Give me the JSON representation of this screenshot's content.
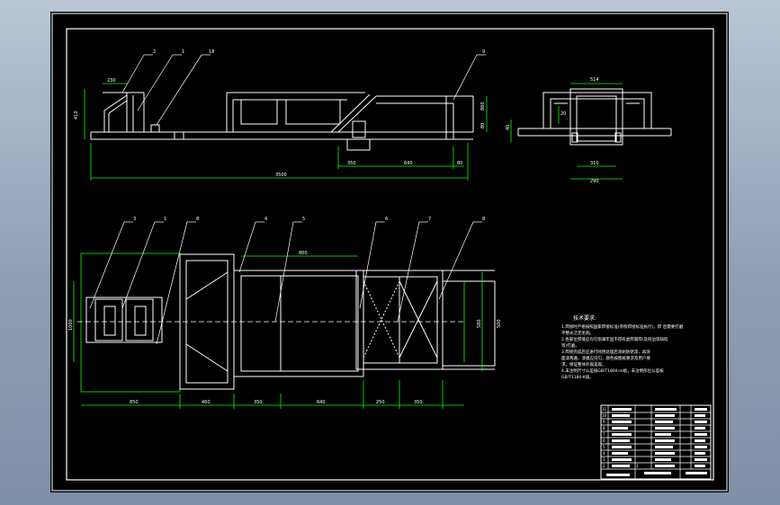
{
  "drawing": {
    "side_view": {
      "dims": [
        "230",
        "410",
        "3500",
        "350",
        "640",
        "80",
        "860",
        "80"
      ],
      "balloons": [
        "2",
        "1",
        "18",
        "9"
      ]
    },
    "end_view": {
      "dims": [
        "514",
        "20",
        "310",
        "290",
        "40"
      ]
    },
    "plan_view": {
      "dims": [
        "800",
        "1000",
        "580",
        "500",
        "850",
        "460",
        "350",
        "640",
        "250",
        "350"
      ],
      "balloons": [
        "3",
        "1",
        "8",
        "4",
        "5",
        "6",
        "7",
        "8"
      ]
    },
    "tech_req": {
      "title": "技术要求:",
      "lines": [
        "1.焊接时严格按照国家焊接标准(参照焊接标准执行)，焊 后需要打磨",
        "平整光洁无毛刺。",
        "2.各部位焊缝应均匀饱满牢固不得有虚焊漏焊(及咬边等缺陷",
        "等)打磨。",
        "3.焊接完成后应进行除锈处理后涂刷防锈漆，再涂",
        "面漆两遍，漆膜应均匀，颜色按图纸要求及用户要",
        "求，保证整体外观美观。",
        "4.未注明尺寸公差按GB/T1804-m级，未注明形位公差按",
        "GB/T1184-K级。"
      ]
    },
    "title_block": {
      "rows": [
        "11",
        "10",
        "9",
        "8",
        "7",
        "6",
        "5",
        "4",
        "3",
        "2",
        "1"
      ]
    }
  }
}
